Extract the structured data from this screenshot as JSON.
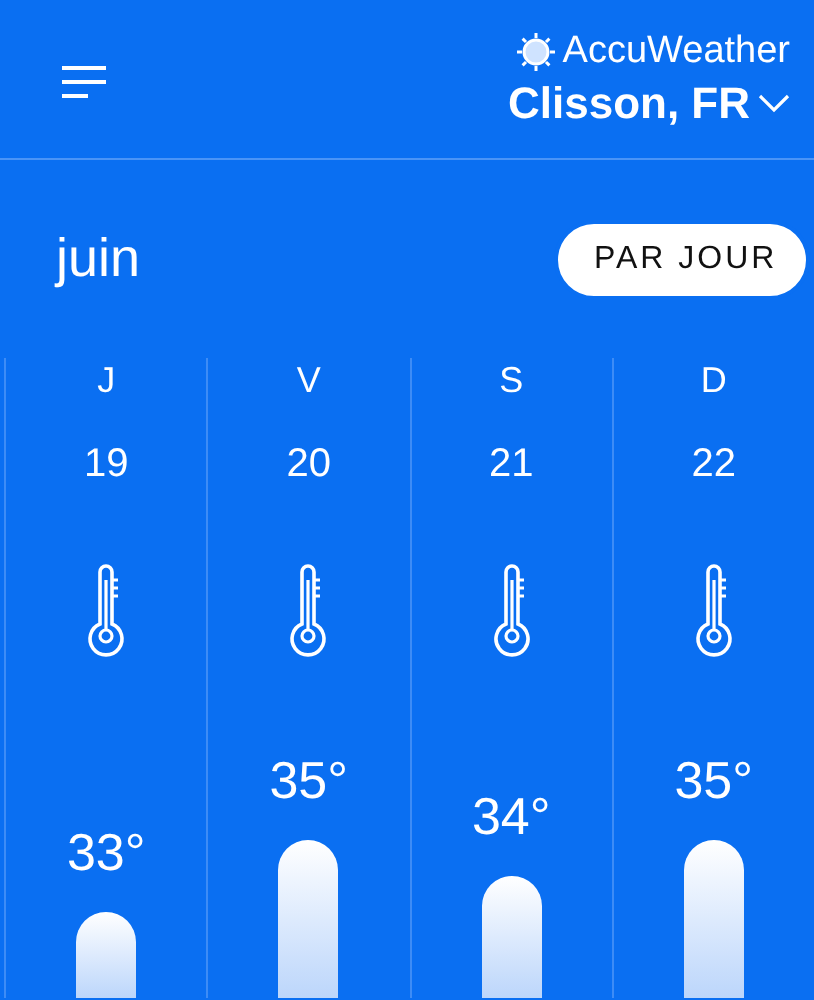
{
  "header": {
    "brand": "AccuWeather",
    "location": "Clisson, FR"
  },
  "month": "juin",
  "view_toggle": {
    "label": "PAR JOUR",
    "selected": true
  },
  "days": [
    {
      "weekday": "J",
      "date": "19",
      "temperature": "33°"
    },
    {
      "weekday": "V",
      "date": "20",
      "temperature": "35°"
    },
    {
      "weekday": "S",
      "date": "21",
      "temperature": "34°"
    },
    {
      "weekday": "D",
      "date": "22",
      "temperature": "35°"
    }
  ]
}
